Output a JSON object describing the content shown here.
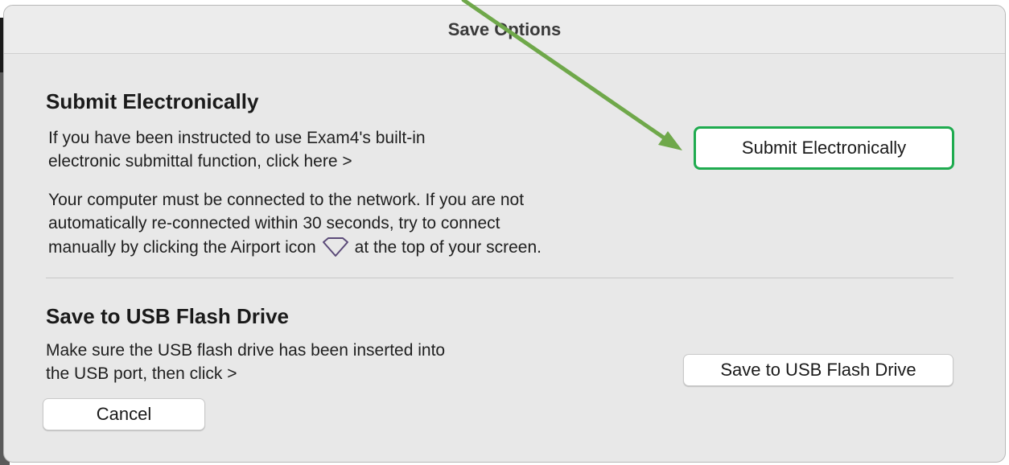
{
  "dialog": {
    "title": "Save Options"
  },
  "submit_section": {
    "heading": "Submit Electronically",
    "instruction_line1": "If you have been instructed to use Exam4's built-in",
    "instruction_line2": "electronic submittal function, click here >",
    "network_line1": "Your computer must be connected to the network. If you are not",
    "network_line2": "automatically re-connected within 30 seconds, try to connect",
    "network_line3_before": "manually by clicking the Airport icon",
    "network_line3_after": "at the top of your screen.",
    "airport_icon": "airport-wifi-icon",
    "button_label": "Submit Electronically"
  },
  "usb_section": {
    "heading": "Save to USB Flash Drive",
    "instruction_line1": "Make sure the USB flash drive has been inserted into",
    "instruction_line2": "the USB port, then click >",
    "button_label": "Save to USB Flash Drive"
  },
  "cancel_button": {
    "label": "Cancel"
  },
  "annotation": {
    "arrow_color": "#6fa84a",
    "highlight_color": "#1fab4f"
  }
}
